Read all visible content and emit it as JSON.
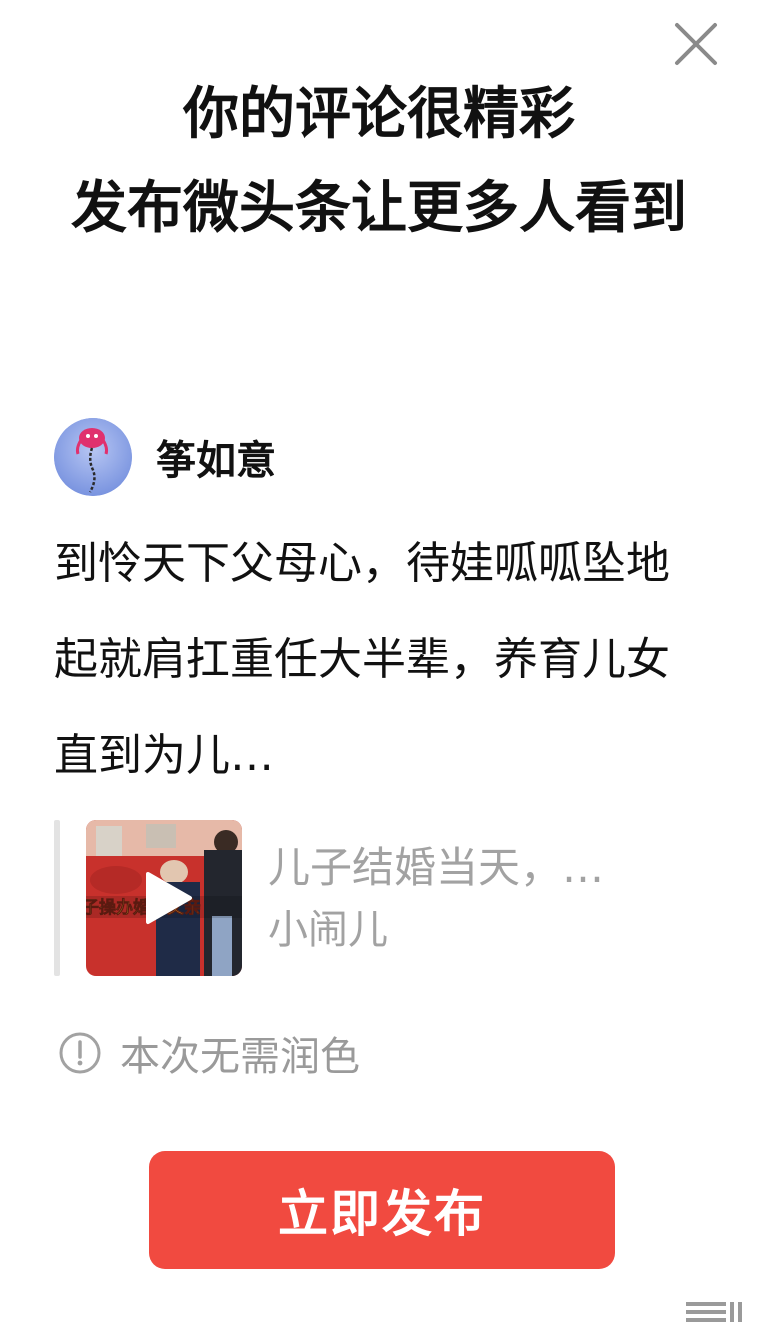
{
  "dialog": {
    "title_line1": "你的评论很精彩",
    "title_line2": "发布微头条让更多人看到",
    "close_icon": "close-icon"
  },
  "author": {
    "name": "筝如意",
    "avatar": "kite-avatar"
  },
  "comment": {
    "text": "到怜天下父母心，待娃呱呱坠地起就肩扛重任大半辈，养育儿女直到为儿…"
  },
  "quoted_video": {
    "title": "儿子结婚当天，…",
    "source": "小闹儿",
    "thumbnail_overlay_text": "子操办婚礼父亲",
    "play_icon": "play-icon"
  },
  "notice": {
    "icon": "info-icon",
    "text": "本次无需润色"
  },
  "actions": {
    "publish_label": "立即发布"
  },
  "colors": {
    "accent": "#f14a40",
    "muted_text": "#a2a2a2",
    "title_text": "#111111"
  }
}
